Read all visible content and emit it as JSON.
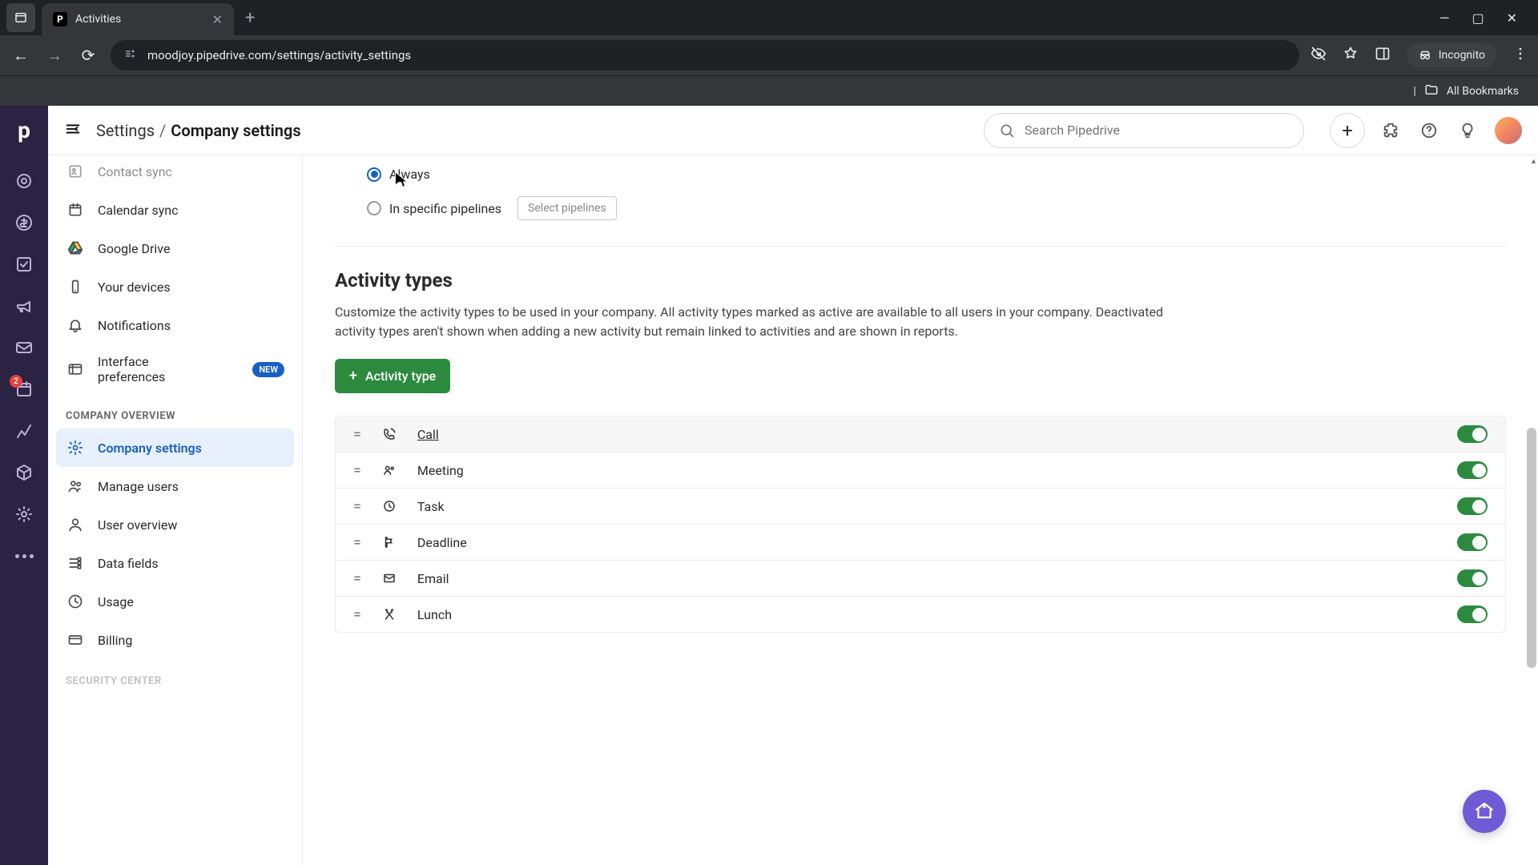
{
  "browser": {
    "tab_title": "Activities",
    "url": "moodjoy.pipedrive.com/settings/activity_settings",
    "incognito_label": "Incognito",
    "all_bookmarks": "All Bookmarks"
  },
  "header": {
    "breadcrumb_parent": "Settings",
    "breadcrumb_sep": "/",
    "breadcrumb_current": "Company settings",
    "search_placeholder": "Search Pipedrive"
  },
  "rail": {
    "badge_count": "2"
  },
  "sidebar": {
    "items_top": [
      {
        "label": "Contact sync",
        "icon": "contact"
      },
      {
        "label": "Calendar sync",
        "icon": "calendar"
      },
      {
        "label": "Google Drive",
        "icon": "gdrive"
      },
      {
        "label": "Your devices",
        "icon": "device"
      },
      {
        "label": "Notifications",
        "icon": "bell"
      },
      {
        "label": "Interface preferences",
        "icon": "interface",
        "badge": "NEW"
      }
    ],
    "section_overview": "COMPANY OVERVIEW",
    "items_overview": [
      {
        "label": "Company settings",
        "icon": "gear",
        "active": true
      },
      {
        "label": "Manage users",
        "icon": "users"
      },
      {
        "label": "User overview",
        "icon": "user"
      },
      {
        "label": "Data fields",
        "icon": "fields"
      },
      {
        "label": "Usage",
        "icon": "usage"
      },
      {
        "label": "Billing",
        "icon": "billing"
      }
    ],
    "section_security": "SECURITY CENTER"
  },
  "content": {
    "radio_always": "Always",
    "radio_pipelines": "In specific pipelines",
    "select_pipelines_btn": "Select pipelines",
    "section_title": "Activity types",
    "section_desc": "Customize the activity types to be used in your company. All activity types marked as active are available to all users in your company. Deactivated activity types aren't shown when adding a new activity but remain linked to activities and are shown in reports.",
    "add_button": "Activity type",
    "types": [
      {
        "label": "Call",
        "icon": "phone",
        "active": true
      },
      {
        "label": "Meeting",
        "icon": "people",
        "active": true
      },
      {
        "label": "Task",
        "icon": "clock",
        "active": true
      },
      {
        "label": "Deadline",
        "icon": "flag",
        "active": true
      },
      {
        "label": "Email",
        "icon": "mail",
        "active": true
      },
      {
        "label": "Lunch",
        "icon": "food",
        "active": true
      }
    ]
  }
}
